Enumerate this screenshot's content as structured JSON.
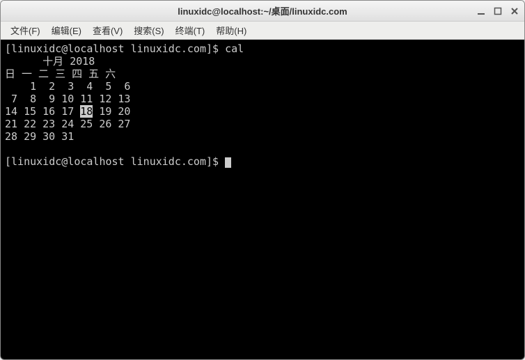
{
  "titlebar": {
    "title": "linuxidc@localhost:~/桌面/linuxidc.com"
  },
  "menubar": {
    "items": [
      "文件(F)",
      "编辑(E)",
      "查看(V)",
      "搜索(S)",
      "终端(T)",
      "帮助(H)"
    ]
  },
  "terminal": {
    "prompt1": "[linuxidc@localhost linuxidc.com]$ ",
    "command1": "cal",
    "cal_title": "      十月 2018",
    "cal_weekdays": "日 一 二 三 四 五 六",
    "cal_rows": [
      [
        "",
        "1",
        "2",
        "3",
        "4",
        "5",
        "6"
      ],
      [
        "7",
        "8",
        "9",
        "10",
        "11",
        "12",
        "13"
      ],
      [
        "14",
        "15",
        "16",
        "17",
        "18",
        "19",
        "20"
      ],
      [
        "21",
        "22",
        "23",
        "24",
        "25",
        "26",
        "27"
      ],
      [
        "28",
        "29",
        "30",
        "31",
        "",
        "",
        ""
      ]
    ],
    "highlight_day": "18",
    "prompt2": "[linuxidc@localhost linuxidc.com]$ "
  }
}
